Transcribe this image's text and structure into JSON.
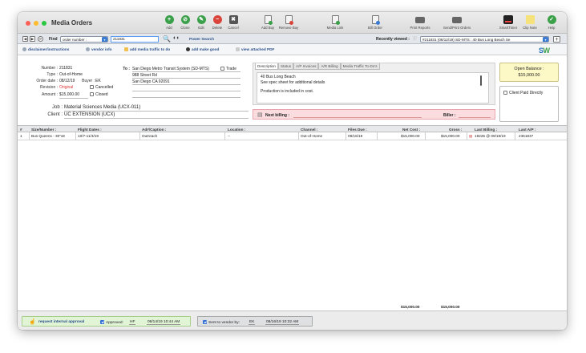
{
  "window": {
    "title": "Media Orders"
  },
  "toolbar": {
    "buttons": [
      {
        "label": "Add",
        "icon": "add-icon"
      },
      {
        "label": "Clone",
        "icon": "clone-icon"
      },
      {
        "label": "Edit",
        "icon": "edit-icon"
      },
      {
        "label": "Delete",
        "icon": "delete-icon"
      },
      {
        "label": "Cancel",
        "icon": "cancel-icon"
      },
      {
        "label": "Add Buy",
        "icon": "add-buy-icon"
      },
      {
        "label": "Remove Buy",
        "icon": "remove-buy-icon"
      },
      {
        "label": "Media Link",
        "icon": "media-link-icon"
      },
      {
        "label": "Bill Order",
        "icon": "bill-order-icon"
      },
      {
        "label": "Print Reports",
        "icon": "printer-icon"
      },
      {
        "label": "Send/Print Orders",
        "icon": "printer-icon"
      },
      {
        "label": "SmartTimer",
        "icon": "timer-icon"
      },
      {
        "label": "Clip Note",
        "icon": "clip-note-icon"
      },
      {
        "label": "Help",
        "icon": "help-icon"
      }
    ]
  },
  "findbar": {
    "find_label": "Find",
    "field_select": "order number :",
    "search_value": "211831",
    "power_search": "Power Search",
    "recently_viewed_label": "Recently viewed :",
    "recently_viewed_value": "#211831 (08/12/19) SD-MTS : 40 Bus Long Beach Se"
  },
  "links": {
    "disclaimer": "disclaimer/instructions",
    "vendor_info": "vendor info",
    "add_media_traffic": "add media traffic to do",
    "add_make_good": "add make good",
    "view_pdf": "view attached PDF"
  },
  "order": {
    "number_label": "Number :",
    "number": "211831",
    "type_label": "Type :",
    "type": "Out-of-Home",
    "order_date_label": "Order date :",
    "order_date": "08/12/19",
    "buyer_label": "Buyer :",
    "buyer": "EK",
    "revision_label": "Revision :",
    "revision": "Original",
    "cancelled_label": "Cancelled",
    "amount_label": "Amount :",
    "amount": "$15,000.00",
    "closed_label": "Closed",
    "job_label": "Job :",
    "job": "Material Sciences Media (UCX-011)",
    "client_label": "Client :",
    "client": "UC EXTENSION (UCX)"
  },
  "to_block": {
    "to_label": "To :",
    "vendor": "San Diego Metro Transit System (SD-MTS)",
    "trade_label": "Trade",
    "address1": "988 Street Rd",
    "address2": "San Diego CA 92091"
  },
  "tabs": [
    "Description",
    "Status",
    "A/P Invoices",
    "A/R Billing",
    "Media Traffic To-Do's"
  ],
  "description": {
    "line1": "40 Bus Long Beach",
    "line2": "See spec sheet for additional details",
    "line3": "Production is included in cost."
  },
  "billing_bar": {
    "next_billing_label": "Next billing :",
    "biller_label": "Biller :"
  },
  "open_balance": {
    "label": "Open Balance :",
    "value": "$15,000.00"
  },
  "client_paid_label": "Client Paid Directly",
  "logo": {
    "text_a": "S",
    "text_b": "W"
  },
  "grid": {
    "columns": [
      "#",
      "Size/Number :",
      "Flight Dates :",
      "Ad#/Caption :",
      "Location :",
      "Channel :",
      "Files Due :",
      "Net Cost :",
      "Gross :",
      "Last Billing :",
      "Last A/P :"
    ],
    "rows": [
      {
        "num": "1",
        "size": "Bus Queens - 30\"x8",
        "flight": "10/7-11/3/19",
        "caption": "Outreach",
        "location": "--",
        "channel": "Out-of-Home",
        "files_due": "09/16/19",
        "net": "$15,000.00",
        "gross": "$15,000.00",
        "last_billing": "19225 @ 09/18/19",
        "last_ap": "2361837"
      }
    ],
    "total_net": "$15,000.00",
    "total_gross": "$15,000.00"
  },
  "footer": {
    "request_approval": "request internal approval",
    "approved_label": "Approved:",
    "approved_by": "HF",
    "approved_at": "08/14/19 10:44 AM",
    "sent_label": "Sent to vendor by:",
    "sent_by": "EK",
    "sent_at": "08/16/19 10:32 AM"
  },
  "colors": {
    "accent": "#3a7bd5",
    "green": "#3ba04a",
    "red": "#d9453a",
    "balance_bg": "#fdf9c6",
    "billing_bg": "#fbdde0"
  }
}
